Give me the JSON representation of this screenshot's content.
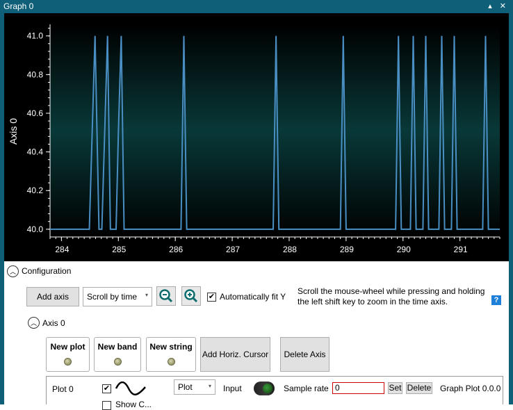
{
  "window": {
    "title": "Graph 0",
    "controls": "▴ ✕"
  },
  "chart_data": {
    "type": "line",
    "ylabel": "Axis 0",
    "xlabel": "",
    "xlim": [
      283.8,
      291.7
    ],
    "ylim": [
      39.96,
      41.06
    ],
    "x_ticks": [
      284,
      285,
      286,
      287,
      288,
      289,
      290,
      291
    ],
    "y_ticks": [
      "40.0",
      "40.2",
      "40.4",
      "40.6",
      "40.8",
      "41.0"
    ],
    "y_tick_values": [
      40.0,
      40.2,
      40.4,
      40.6,
      40.8,
      41.0
    ],
    "x_tick_labels": [
      "284",
      "285",
      "286",
      "287",
      "288",
      "289",
      "290",
      "291"
    ],
    "line_color": "#4a8fc4",
    "series": [
      {
        "x": [
          283.8,
          284.49,
          284.54,
          284.59,
          284.66,
          284.71,
          284.76,
          284.81,
          284.86,
          284.91,
          284.96,
          285.0,
          285.05,
          285.1,
          285.15,
          285.2,
          286.1,
          286.15,
          286.2,
          286.25,
          287.72,
          287.77,
          287.82,
          287.87,
          288.9,
          288.95,
          289.0,
          289.05,
          289.87,
          289.92,
          289.97,
          290.02,
          290.13,
          290.18,
          290.23,
          290.28,
          290.35,
          290.4,
          290.45,
          290.5,
          290.63,
          290.68,
          290.73,
          290.78,
          290.85,
          290.9,
          290.95,
          291.0,
          291.4,
          291.45,
          291.5,
          291.55,
          291.7
        ],
        "y": [
          40.0,
          40.0,
          40.5,
          41.0,
          40.0,
          40.0,
          40.5,
          41.0,
          40.0,
          40.0,
          40.0,
          40.5,
          41.0,
          40.0,
          40.0,
          40.0,
          40.0,
          41.0,
          40.0,
          40.0,
          40.0,
          41.0,
          40.0,
          40.0,
          40.0,
          41.0,
          40.0,
          40.0,
          40.0,
          41.0,
          40.0,
          40.0,
          40.0,
          41.0,
          40.0,
          40.0,
          40.0,
          41.0,
          40.0,
          40.0,
          40.0,
          41.0,
          40.0,
          40.0,
          40.0,
          41.0,
          40.0,
          40.0,
          40.0,
          41.0,
          40.0,
          40.0,
          40.0
        ]
      }
    ]
  },
  "config": {
    "header": "Configuration",
    "add_axis": "Add axis",
    "scroll_mode": "Scroll by time",
    "auto_fit": "Automatically fit Y",
    "auto_fit_checked": "✔",
    "hint": "Scroll the mouse-wheel while pressing and holding the left shift key to zoom in the time axis.",
    "help": "?"
  },
  "axis": {
    "header": "Axis 0",
    "new_plot": "New plot",
    "new_band": "New band",
    "new_string": "New string",
    "add_cursor": "Add Horiz. Cursor",
    "delete_axis": "Delete Axis"
  },
  "plot": {
    "name": "Plot 0",
    "checked": "✔",
    "type": "Plot",
    "input_label": "Input",
    "sample_rate_label": "Sample rate",
    "sample_rate": "0",
    "set": "Set",
    "delete": "Delete",
    "caption": "Graph Plot 0.0.0",
    "show_label": "Show C..."
  }
}
